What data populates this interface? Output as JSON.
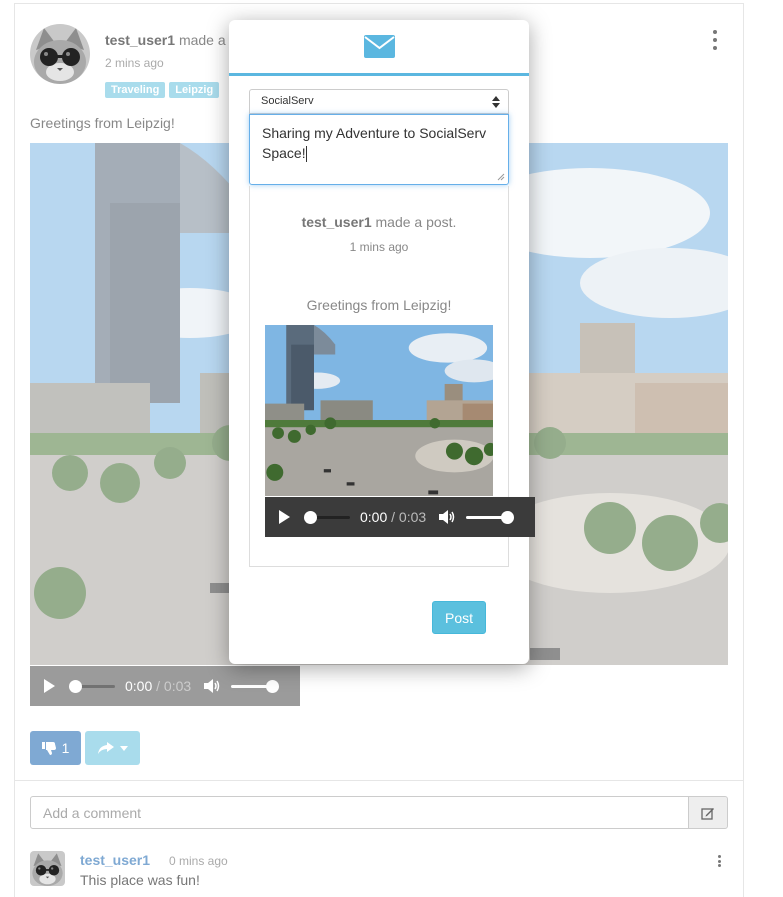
{
  "post": {
    "author": "test_user1",
    "action_text": "made a",
    "timestamp": "2 mins ago",
    "tags": [
      "Traveling",
      "Leipzig"
    ],
    "text": "Greetings from Leipzig!",
    "video": {
      "current_time": "0:00",
      "separator": "/",
      "duration": "0:03",
      "progress": 0,
      "volume": 1.0
    },
    "like_count": "1"
  },
  "comments": {
    "input_placeholder": "Add a comment",
    "items": [
      {
        "author": "test_user1",
        "time": "0 mins ago",
        "text": "This place was fun!"
      }
    ]
  },
  "share_modal": {
    "destination": "SocialServ",
    "message": "Sharing my Adventure to SocialServ Space!",
    "preview": {
      "author": "test_user1",
      "action_text": "made a post.",
      "time": "1 mins ago",
      "text": "Greetings from Leipzig!",
      "video": {
        "current_time": "0:00",
        "separator": "/",
        "duration": "0:03"
      }
    },
    "submit_label": "Post"
  },
  "colors": {
    "accent_blue": "#5bb7e0",
    "tag_bg": "#a9dcec",
    "like_bg": "#7fa9d3",
    "post_button": "#5bc0de"
  },
  "icons": [
    "envelope-icon",
    "thumbs-down-icon",
    "share-icon",
    "edit-icon",
    "volume-icon",
    "play-icon",
    "kebab-menu-icon"
  ]
}
